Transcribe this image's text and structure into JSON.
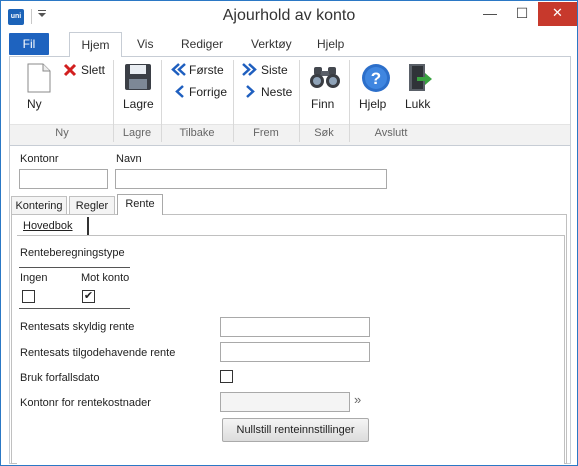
{
  "window": {
    "title": "Ajourhold av konto",
    "logo_text": "uni",
    "minimize": "—",
    "maximize": "☐",
    "close": "✕"
  },
  "ribbon_tabs": {
    "fil": "Fil",
    "hjem": "Hjem",
    "vis": "Vis",
    "rediger": "Rediger",
    "verktoy": "Verktøy",
    "hjelp": "Hjelp"
  },
  "ribbon": {
    "ny": "Ny",
    "slett": "Slett",
    "lagre": "Lagre",
    "forste": "Første",
    "forrige": "Forrige",
    "siste": "Siste",
    "neste": "Neste",
    "finn": "Finn",
    "hjelp": "Hjelp",
    "lukk": "Lukk",
    "groups": {
      "ny": "Ny",
      "lagre": "Lagre",
      "tilbake": "Tilbake",
      "frem": "Frem",
      "sok": "Søk",
      "avslutt": "Avslutt"
    }
  },
  "header_fields": {
    "kontonr_label": "Kontonr",
    "kontonr_value": "",
    "navn_label": "Navn",
    "navn_value": ""
  },
  "subtabs": {
    "kontering": "Kontering",
    "regler": "Regler",
    "rente": "Rente",
    "active": "Rente"
  },
  "inner_tab": {
    "label": "Hovedbok"
  },
  "rente": {
    "type_heading": "Renteberegningstype",
    "ingen_label": "Ingen",
    "ingen_checked": false,
    "mot_konto_label": "Mot konto",
    "mot_konto_checked": true,
    "check_mark": "✔",
    "skyldig_label": "Rentesats skyldig rente",
    "skyldig_value": "",
    "tilgode_label": "Rentesats tilgodehavende rente",
    "tilgode_value": "",
    "forfall_label": "Bruk forfallsdato",
    "forfall_checked": false,
    "kostnad_label": "Kontonr for rentekostnader",
    "kostnad_value": "",
    "lookup_icon": "»",
    "reset_button": "Nullstill renteinnstillinger"
  },
  "colors": {
    "accent": "#1e63bf",
    "close": "#c7392c",
    "arrow_blue": "#1f5fbf",
    "delete_red": "#d21f1f"
  }
}
